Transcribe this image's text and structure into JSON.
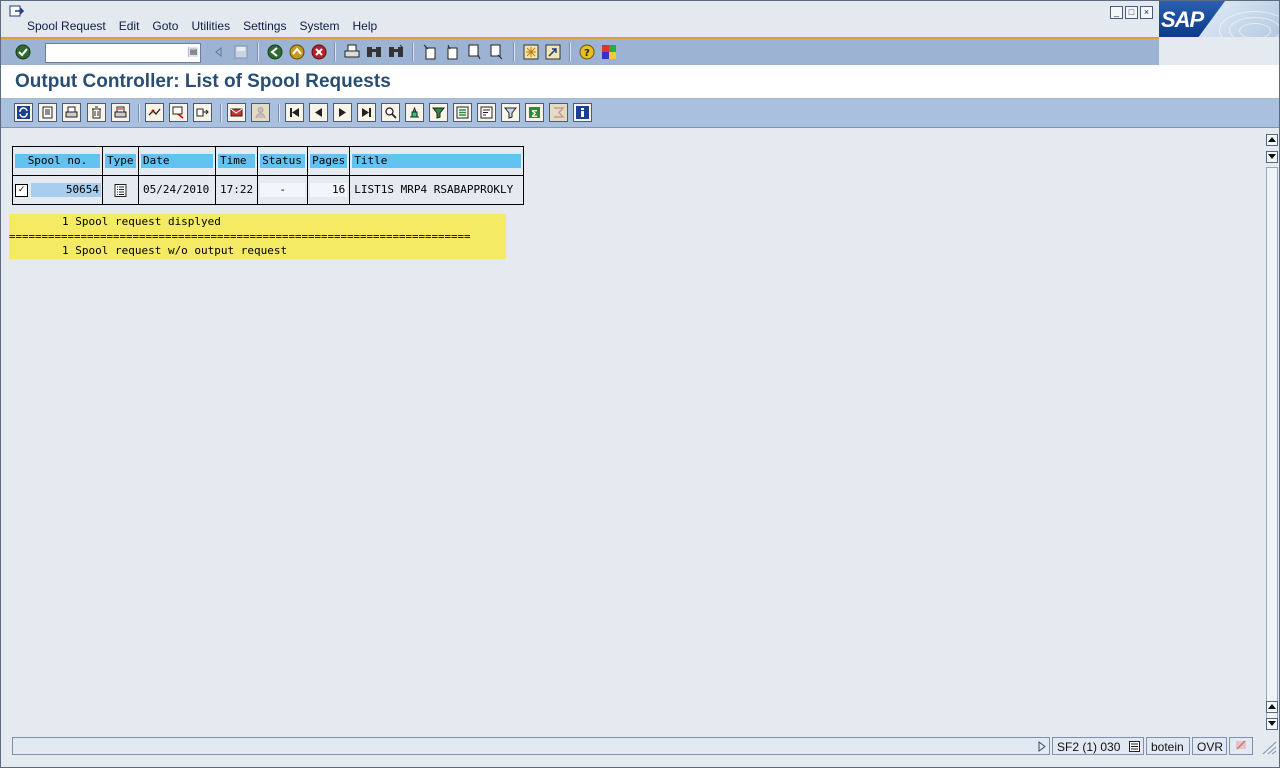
{
  "menu": {
    "items": [
      "Spool Request",
      "Edit",
      "Goto",
      "Utilities",
      "Settings",
      "System",
      "Help"
    ]
  },
  "window_buttons": [
    "minimize-icon",
    "restore-icon",
    "close-icon"
  ],
  "logo": {
    "text": "SAP"
  },
  "command_field": {
    "value": ""
  },
  "page": {
    "title": "Output Controller: List of Spool Requests"
  },
  "table": {
    "headers": [
      "Spool no.",
      "Type",
      "Date",
      "Time",
      "Status",
      "Pages",
      "Title"
    ],
    "rows": [
      {
        "checked": true,
        "spool_no": "50654",
        "type_icon": "list-document-icon",
        "date": "05/24/2010",
        "time": "17:22",
        "status": "-",
        "pages": "16",
        "title": "LIST1S MRP4 RSABAPPROKLY"
      }
    ]
  },
  "messages": {
    "line1": "        1 Spool request displyed",
    "separator": "=======================================================================",
    "line2": "        1 Spool request w/o output request"
  },
  "status_bar": {
    "message": "",
    "system": "SF2 (1) 030",
    "user": "botein",
    "mode": "OVR"
  },
  "colors": {
    "header_highlight": "#62c2f2",
    "message_highlight": "#f5ea63",
    "title_text": "#2a4d74",
    "toolbar_bg": "#9cb3d3",
    "accent_line": "#e0a030"
  }
}
